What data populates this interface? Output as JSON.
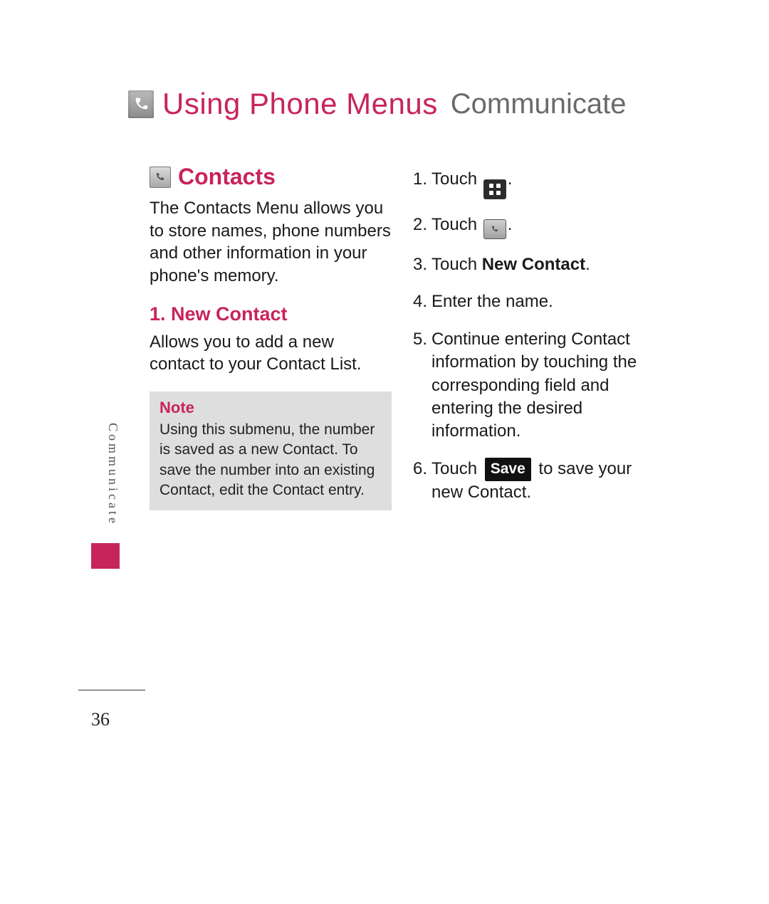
{
  "chapter": {
    "title_main": "Using Phone Menus",
    "title_sub": "Communicate"
  },
  "left": {
    "section_title": "Contacts",
    "section_text": "The Contacts Menu allows you to store names, phone numbers and other information in your phone's memory.",
    "sub_title": "1. New Contact",
    "sub_text": "Allows you to add a new contact to your Contact List.",
    "note_title": "Note",
    "note_text": "Using this submenu, the number is saved as a new Contact. To save the number into an existing Contact, edit the Contact entry."
  },
  "steps": {
    "s1_prefix": "Touch ",
    "s1_suffix": ".",
    "s2_prefix": "Touch ",
    "s2_suffix": ".",
    "s3_prefix": "Touch ",
    "s3_bold": "New Contact",
    "s3_suffix": ".",
    "s4": "Enter the name.",
    "s5": "Continue entering Contact information by touching the corresponding field and entering the desired information.",
    "s6_prefix": "Touch ",
    "s6_button": "Save",
    "s6_suffix": " to save your new Contact."
  },
  "side_tab": "Communicate",
  "page_number": "36"
}
